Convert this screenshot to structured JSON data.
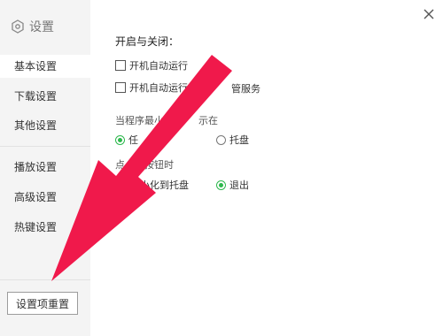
{
  "sidebar": {
    "title": "设置",
    "items": [
      {
        "label": "基本设置",
        "active": true
      },
      {
        "label": "下载设置",
        "active": false
      },
      {
        "label": "其他设置",
        "active": false
      },
      {
        "label": "播放设置",
        "active": false
      },
      {
        "label": "高级设置",
        "active": false
      },
      {
        "label": "热键设置",
        "active": false
      }
    ],
    "reset_label": "设置项重置"
  },
  "main": {
    "section_title": "开启与关闭：",
    "checkboxes": [
      {
        "label": "开机自动运行",
        "checked": false
      },
      {
        "label_left": "开机自动运行",
        "label_right": "管服务",
        "checked": false
      }
    ],
    "minimize_group": {
      "label_left": "当程序最小",
      "label_right": "示在",
      "options": [
        {
          "label": "任",
          "checked": true
        },
        {
          "label": "托盘",
          "checked": false
        }
      ]
    },
    "close_group": {
      "label_left": "点",
      "label_right": "按钮时",
      "options": [
        {
          "label": "小化到托盘",
          "checked": false
        },
        {
          "label": "退出",
          "checked": true
        }
      ]
    }
  },
  "colors": {
    "accent_green": "#2db84d",
    "arrow_red": "#f0194b",
    "sidebar_bg": "#f4f4f4"
  },
  "icons": {
    "settings": "hexagon-gear-icon",
    "close": "close-icon",
    "overlay": "red-arrow-annotation"
  }
}
